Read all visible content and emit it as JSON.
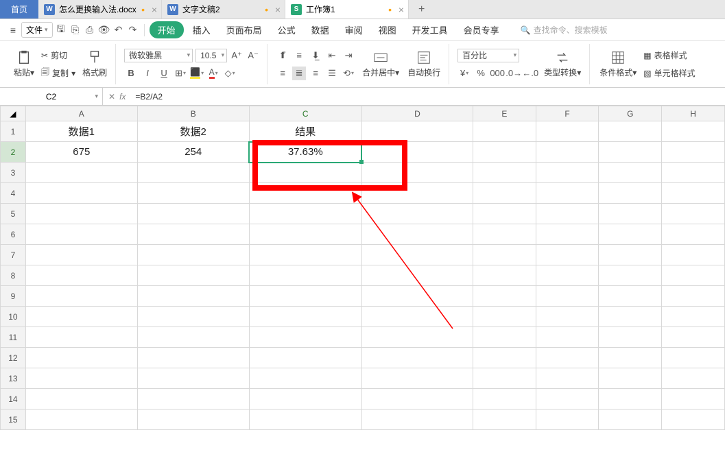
{
  "tabs": {
    "home": "首页",
    "doc1": "怎么更换输入法.docx",
    "doc2": "文字文稿2",
    "doc3": "工作簿1"
  },
  "menubar": {
    "file": "文件",
    "items": [
      "开始",
      "插入",
      "页面布局",
      "公式",
      "数据",
      "审阅",
      "视图",
      "开发工具",
      "会员专享"
    ],
    "search_ph": "查找命令、搜索模板"
  },
  "ribbon": {
    "paste": "粘贴",
    "cut": "剪切",
    "copy": "复制",
    "fmtpaint": "格式刷",
    "font": "微软雅黑",
    "size": "10.5",
    "merge": "合并居中",
    "wrap": "自动换行",
    "numfmt": "百分比",
    "typeconv": "类型转换",
    "condfmt": "条件格式",
    "tablestyle": "表格样式",
    "cellstyle": "单元格样式"
  },
  "namebox": "C2",
  "formula": "=B2/A2",
  "columns": [
    "A",
    "B",
    "C",
    "D",
    "E",
    "F",
    "G",
    "H"
  ],
  "rows": [
    "1",
    "2",
    "3",
    "4",
    "5",
    "6",
    "7",
    "8",
    "9",
    "10",
    "11",
    "12",
    "13",
    "14",
    "15"
  ],
  "header_row": {
    "A": "数据1",
    "B": "数据2",
    "C": "结果"
  },
  "data_row": {
    "A": "675",
    "B": "254",
    "C": "37.63%"
  },
  "colw": {
    "A": 170,
    "B": 170,
    "C": 170,
    "D": 170,
    "E": 96,
    "F": 96,
    "G": 96,
    "H": 96
  }
}
